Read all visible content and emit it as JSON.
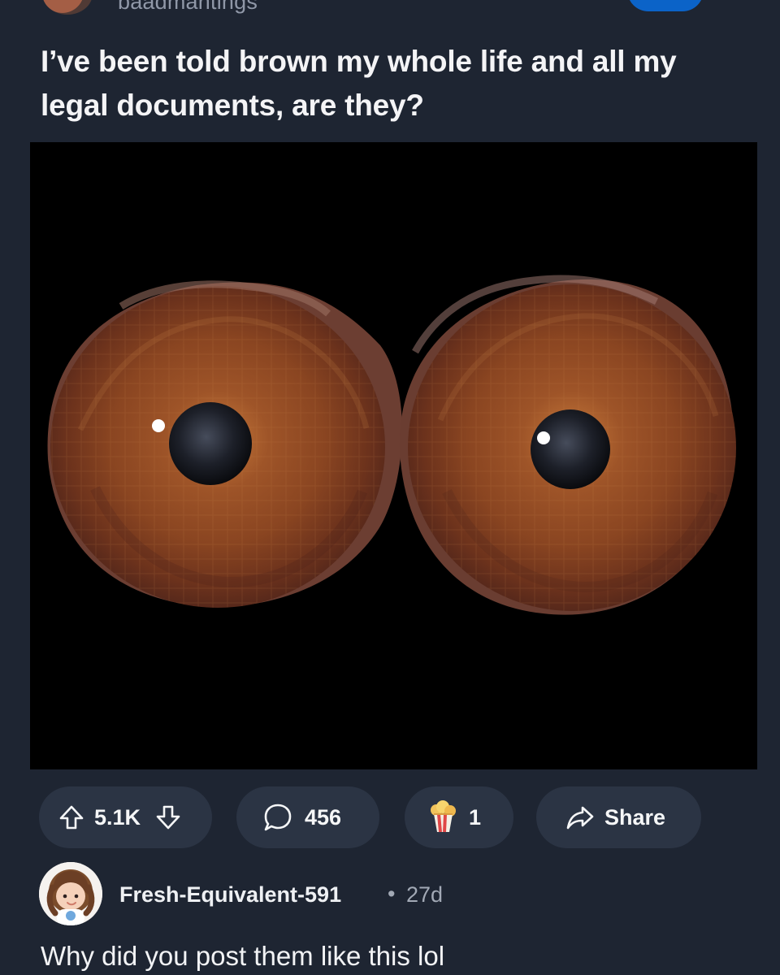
{
  "post": {
    "author": "baadmantings",
    "title": "I’ve been told brown my whole life and all my legal documents, are they?"
  },
  "actions": {
    "upvotes": "5.1K",
    "comments": "456",
    "awards": "1",
    "share_label": "Share"
  },
  "comment": {
    "author": "Fresh-Equivalent-591",
    "separator": "•",
    "time": "27d",
    "body": "Why did you post them like this lol"
  },
  "colors": {
    "background": "#1e2532",
    "pill": "#2b3444",
    "accent": "#0b63c8",
    "iris": "#8d4a22"
  },
  "icons": {
    "upvote": "arrow-up-icon",
    "downvote": "arrow-down-icon",
    "comment": "speech-bubble-icon",
    "award": "popcorn-award-icon",
    "share": "share-arrow-icon"
  }
}
